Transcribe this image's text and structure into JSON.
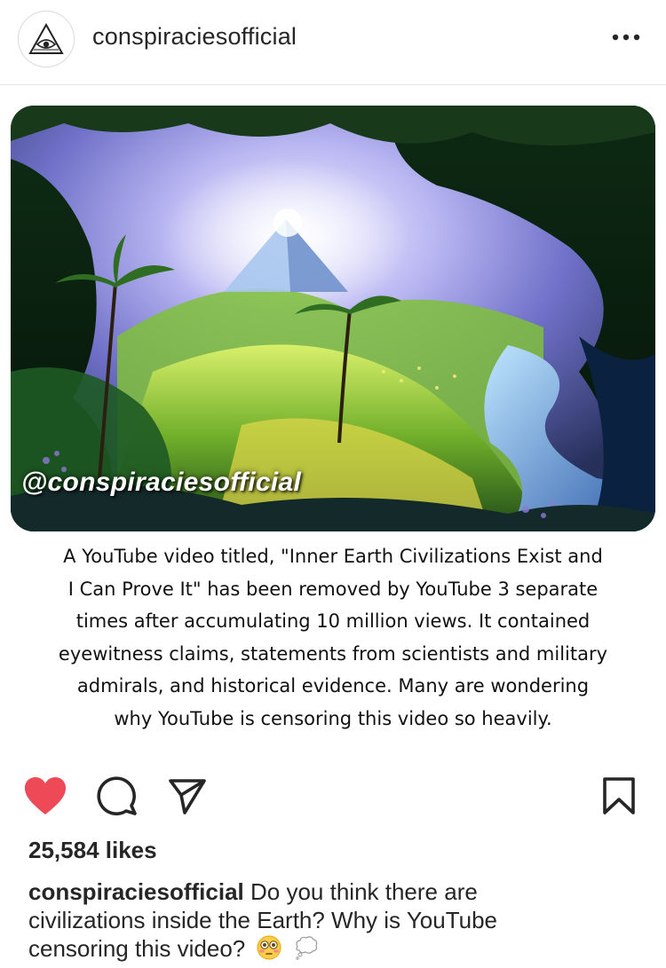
{
  "header": {
    "username": "conspiraciesofficial"
  },
  "post": {
    "watermark": "@conspiraciesofficial",
    "image_text_lines": [
      "A YouTube video titled, \"Inner Earth Civilizations Exist and",
      "I Can Prove It\" has been removed by YouTube 3 separate",
      "times after accumulating 10 million views. It contained",
      "eyewitness claims, statements from scientists and military",
      "admirals, and historical evidence. Many are wondering",
      "why YouTube is censoring this video so heavily."
    ]
  },
  "actions": {
    "liked": true,
    "like_color": "#ed4956"
  },
  "likes": "25,584 likes",
  "caption": {
    "username": "conspiraciesofficial",
    "text": "Do you think there are civilizations inside the Earth? Why is YouTube censoring this video?"
  }
}
